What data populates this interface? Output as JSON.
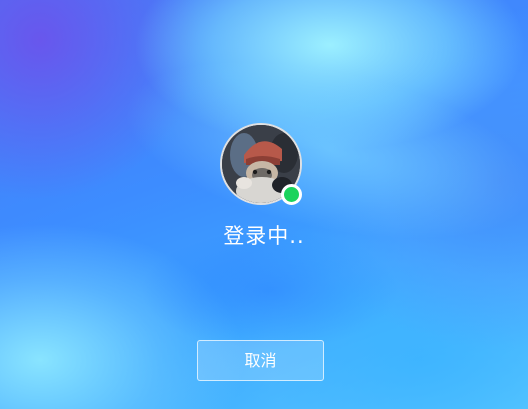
{
  "login": {
    "status_text": "登录中..",
    "cancel_label": "取消",
    "online_status_color": "#1bd35c"
  },
  "avatar": {
    "icon": "user-avatar-photo"
  }
}
